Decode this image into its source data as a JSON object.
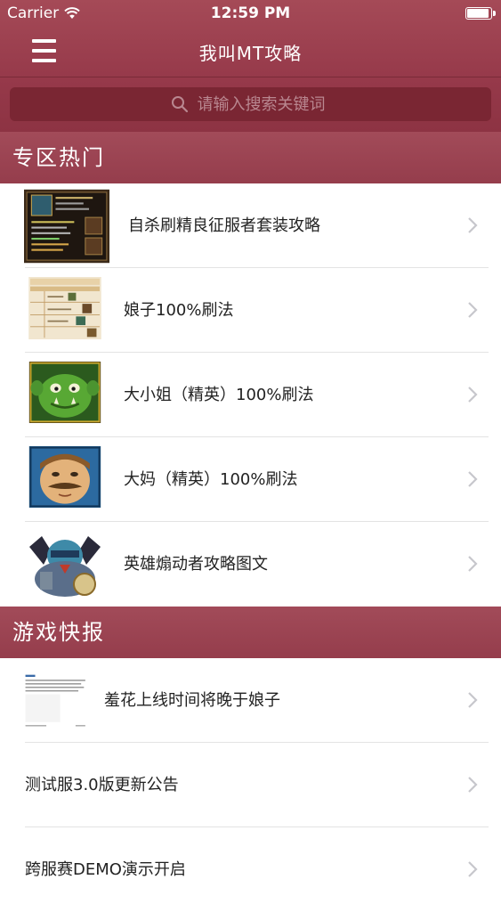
{
  "status_bar": {
    "carrier": "Carrier",
    "time": "12:59 PM"
  },
  "nav": {
    "title": "我叫MT攻略"
  },
  "search": {
    "placeholder": "请输入搜索关键词"
  },
  "sections": [
    {
      "title": "专区热门",
      "items": [
        {
          "label": "自杀刷精良征服者套装攻略",
          "thumb": "item-tooltip-screenshot"
        },
        {
          "label": "娘子100%刷法",
          "thumb": "table-screenshot"
        },
        {
          "label": "大小姐（精英）100%刷法",
          "thumb": "green-ogre-portrait"
        },
        {
          "label": "大妈（精英）100%刷法",
          "thumb": "mustached-man-portrait"
        },
        {
          "label": "英雄煽动者攻略图文",
          "thumb": "armored-warrior-portrait"
        }
      ]
    },
    {
      "title": "游戏快报",
      "items": [
        {
          "label": "羞花上线时间将晚于娘子",
          "thumb": "news-text-screenshot"
        },
        {
          "label": "测试服3.0版更新公告"
        },
        {
          "label": "跨服赛DEMO演示开启"
        }
      ]
    }
  ],
  "colors": {
    "accent": "#96394a",
    "search_bg": "#7a2633",
    "separator": "#e3e3e3"
  }
}
